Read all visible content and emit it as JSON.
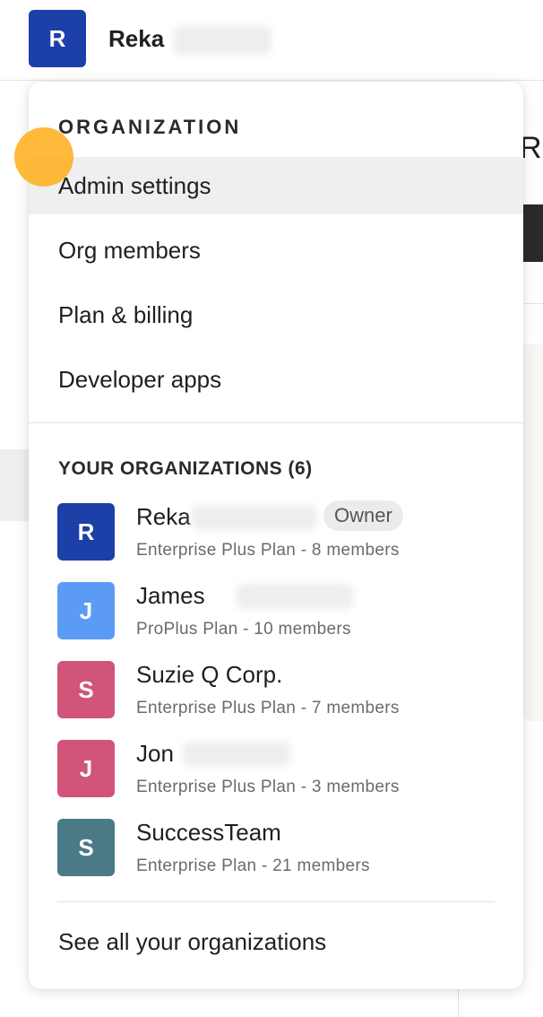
{
  "header": {
    "avatar_letter": "R",
    "avatar_color": "#1d3fa8",
    "user_first_name": "Reka"
  },
  "background": {
    "heading_fragment": "Re"
  },
  "menu": {
    "organization_title": "ORGANIZATION",
    "items": [
      {
        "label": "Admin settings",
        "active": true
      },
      {
        "label": "Org members",
        "active": false
      },
      {
        "label": "Plan & billing",
        "active": false
      },
      {
        "label": "Developer apps",
        "active": false
      }
    ],
    "your_orgs_title": "YOUR ORGANIZATIONS (6)",
    "orgs": [
      {
        "letter": "R",
        "name": "Reka",
        "badge": "Owner",
        "plan": "Enterprise Plus Plan - 8 members",
        "color": "#1d3fa8"
      },
      {
        "letter": "J",
        "name": "James",
        "plan": "ProPlus Plan - 10 members",
        "color": "#5b9bf5"
      },
      {
        "letter": "S",
        "name": "Suzie Q Corp.",
        "plan": "Enterprise Plus Plan - 7 members",
        "color": "#d05578"
      },
      {
        "letter": "J",
        "name": "Jon",
        "plan": "Enterprise Plus Plan - 3 members",
        "color": "#d05578"
      },
      {
        "letter": "S",
        "name": "SuccessTeam",
        "plan": "Enterprise Plan - 21 members",
        "color": "#4a7a85"
      }
    ],
    "see_all_label": "See all your organizations"
  },
  "colors": {
    "active_item_bg": "#efefef",
    "cursor_indicator": "#ffb020"
  }
}
